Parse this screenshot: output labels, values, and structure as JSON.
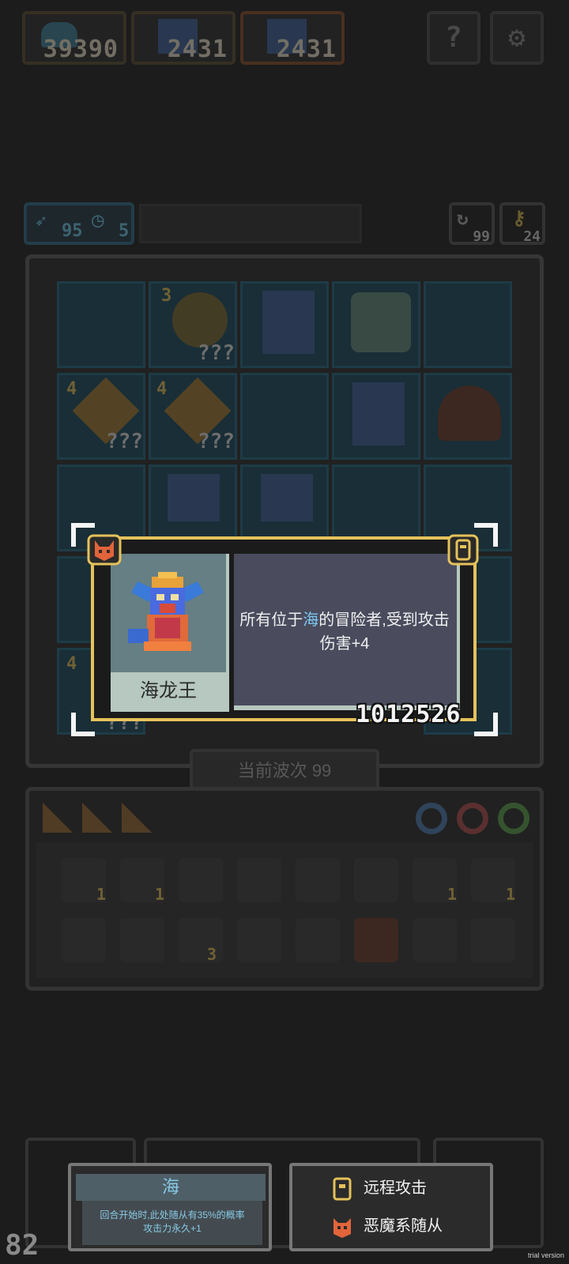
{
  "top_bar": {
    "gold": "39390",
    "unit1_count": "2431",
    "unit2_count": "2431",
    "help_label": "?",
    "settings_icon": "gear-icon"
  },
  "status_bar": {
    "attack_count": "95",
    "timer_count": "5",
    "reroll_count": "99",
    "key_count": "24"
  },
  "board": {
    "wave_label": "当前波次 99",
    "unknown_marks": [
      "???",
      "???",
      "???",
      "???"
    ],
    "level_badges": [
      "3",
      "4",
      "4",
      "4"
    ]
  },
  "popup": {
    "unit_name": "海龙王",
    "desc_prefix": "所有位于",
    "desc_highlight": "海",
    "desc_suffix": "的冒险者,受到攻击伤害+4",
    "power": "1012526",
    "badge_left": "demon-icon",
    "badge_right": "ranged-icon"
  },
  "inventory": {
    "counts": [
      "1",
      "1",
      "1",
      "1",
      "3"
    ]
  },
  "bottom": {
    "terrain_title": "海",
    "terrain_desc_line1": "回合开始时,此处随从有35%的概率",
    "terrain_desc_line2": "攻击力永久+1",
    "trait1": "远程攻击",
    "trait2": "恶魔系随从",
    "level": "82"
  },
  "watermark": "trial version",
  "colors": {
    "gold_frame": "#e5c25a",
    "sea_text": "#7cc9f0",
    "desc_panel": "#4a4c5e",
    "portrait_bg": "#657f84"
  }
}
